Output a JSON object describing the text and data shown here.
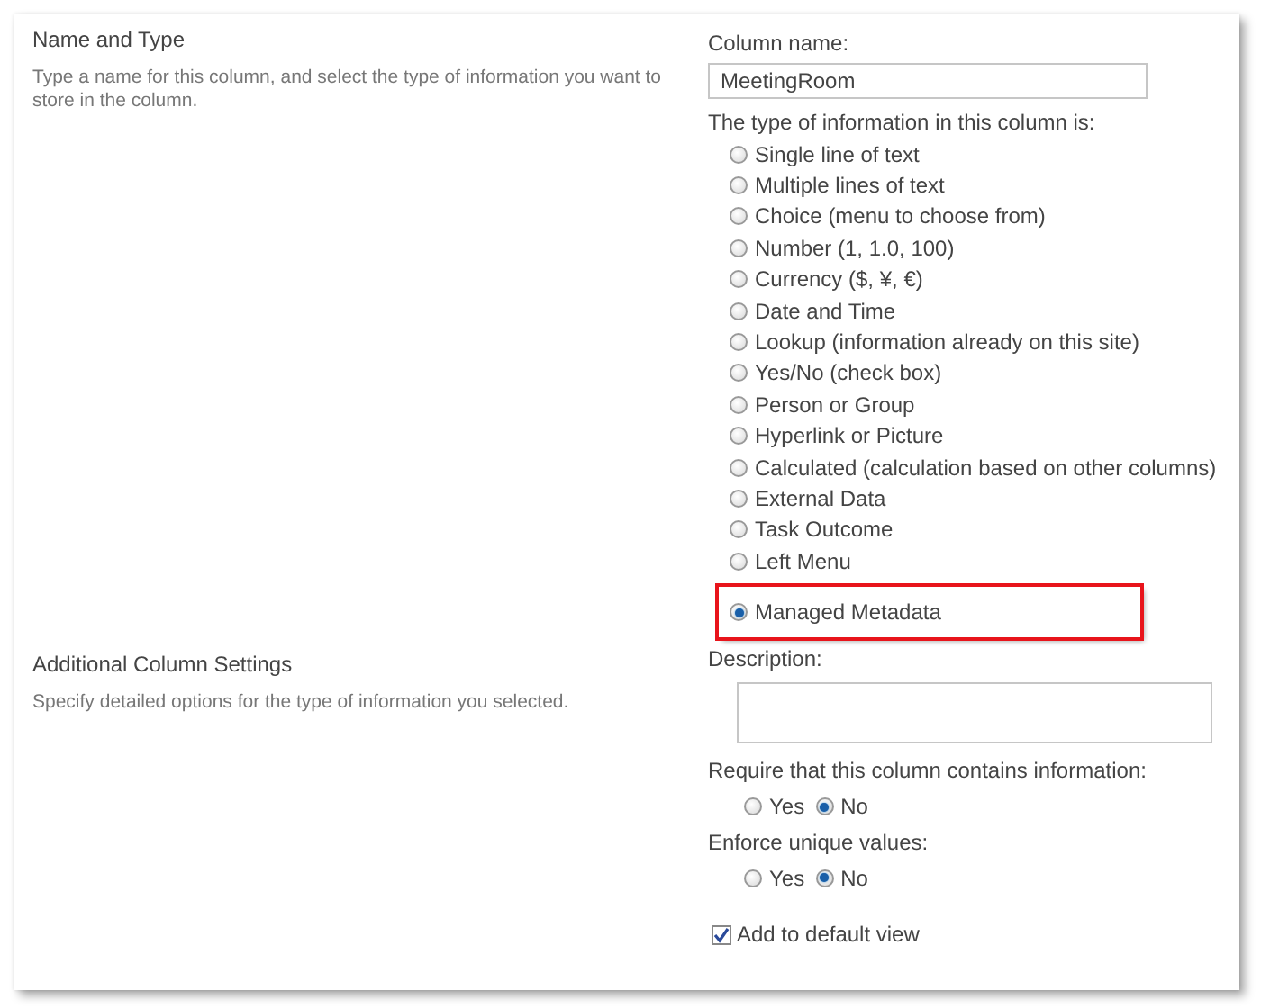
{
  "sections": [
    {
      "title": "Name and Type",
      "description": "Type a name for this column, and select the type of information you want to store in the column."
    },
    {
      "title": "Additional Column Settings",
      "description": "Specify detailed options for the type of information you selected."
    }
  ],
  "column_name": {
    "label": "Column name:",
    "value": "MeetingRoom"
  },
  "type_question": "The type of information in this column is:",
  "types": [
    {
      "label": "Single line of text",
      "selected": false,
      "highlighted": false
    },
    {
      "label": "Multiple lines of text",
      "selected": false,
      "highlighted": false
    },
    {
      "label": "Choice (menu to choose from)",
      "selected": false,
      "highlighted": false
    },
    {
      "label": "Number (1, 1.0, 100)",
      "selected": false,
      "highlighted": false
    },
    {
      "label": "Currency ($, ¥, €)",
      "selected": false,
      "highlighted": false
    },
    {
      "label": "Date and Time",
      "selected": false,
      "highlighted": false
    },
    {
      "label": "Lookup (information already on this site)",
      "selected": false,
      "highlighted": false
    },
    {
      "label": "Yes/No (check box)",
      "selected": false,
      "highlighted": false
    },
    {
      "label": "Person or Group",
      "selected": false,
      "highlighted": false
    },
    {
      "label": "Hyperlink or Picture",
      "selected": false,
      "highlighted": false
    },
    {
      "label": "Calculated (calculation based on other columns)",
      "selected": false,
      "highlighted": false
    },
    {
      "label": "External Data",
      "selected": false,
      "highlighted": false
    },
    {
      "label": "Task Outcome",
      "selected": false,
      "highlighted": false
    },
    {
      "label": "Left Menu",
      "selected": false,
      "highlighted": false
    },
    {
      "label": "Managed Metadata",
      "selected": true,
      "highlighted": true
    }
  ],
  "description_field": {
    "label": "Description:"
  },
  "questions": [
    {
      "label": "Require that this column contains information:",
      "options": [
        {
          "label": "Yes",
          "selected": false
        },
        {
          "label": "No",
          "selected": true
        }
      ]
    },
    {
      "label": "Enforce unique values:",
      "options": [
        {
          "label": "Yes",
          "selected": false
        },
        {
          "label": "No",
          "selected": true
        }
      ]
    }
  ],
  "default_view": {
    "label": "Add to default view",
    "checked": true
  }
}
